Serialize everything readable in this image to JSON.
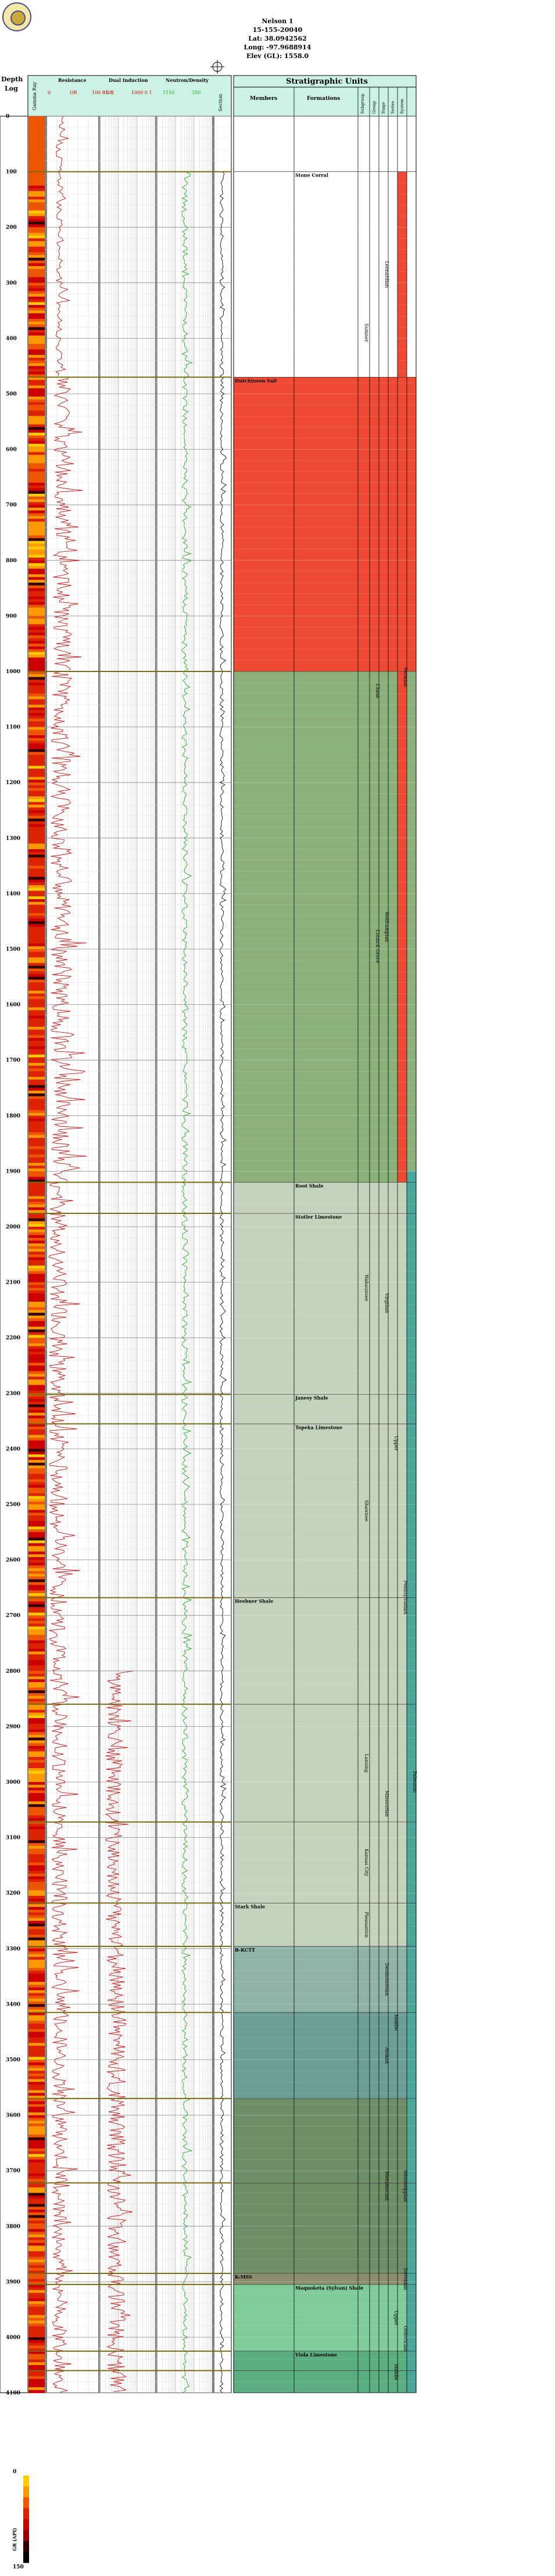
{
  "header": {
    "well_name": "Nelson 1",
    "api": "15-155-20040",
    "lat": "Lat: 38.0942562",
    "long": "Long: -97.9688914",
    "elev": "Elev (GL): 1558.0"
  },
  "track_headers": {
    "depth": "Depth",
    "log": "Log",
    "gamma": "Gamma Ray",
    "resistance": "Resistance",
    "resistance_scale": [
      "0",
      "OR",
      "100 0 0 2"
    ],
    "induction": "Dual Induction",
    "induction_scale": [
      "31.8",
      "1000 0 1"
    ],
    "neutron": "Neutron/Density",
    "neutron_scale": [
      "1150",
      "350"
    ],
    "section": "Section",
    "strat_title": "Stratigraphic Units",
    "members": "Members",
    "formations": "Formations",
    "subgroup": "Subgroup",
    "group": "Group",
    "stage": "Stage",
    "series": "Series",
    "system": "System"
  },
  "colors": {
    "header_fill": "#ccf2e6",
    "permian": "#ee4a33",
    "pennsylvanian_light": "#8cb07a",
    "pennsylvanian_upper": "#c4d3bb",
    "pennsylvanian_middle": "#8fb3a7",
    "atokan": "#6a9e96",
    "mississippian": "#6e8e67",
    "devonian": "#7fcb9a",
    "ordovician": "#5aae7f",
    "curve_red": "#cc1111",
    "curve_green": "#22aa22"
  },
  "chart_data": {
    "type": "well_log",
    "depth_label": "Depth",
    "depth_ticks": [
      "0",
      "100",
      "200",
      "300",
      "400",
      "500",
      "600",
      "700",
      "800",
      "900",
      "1000",
      "1100",
      "1200",
      "1300",
      "1400",
      "1500",
      "1600",
      "1700",
      "1800",
      "1900",
      "2000",
      "2100",
      "2200",
      "2300",
      "2400",
      "2500",
      "2600",
      "2700",
      "2800",
      "2900",
      "3000",
      "3100",
      "3200",
      "3300",
      "3400",
      "3500",
      "3600",
      "3700",
      "3800",
      "3900",
      "4000",
      "4100"
    ],
    "depth_range": [
      0,
      4100
    ],
    "formation_tops": [
      {
        "name": "Stone Corral",
        "depth": 100
      },
      {
        "name": "Hutchinson Salt",
        "depth": 470
      },
      {
        "name": "",
        "depth": 1000
      },
      {
        "name": "Root Shale",
        "depth": 1920
      },
      {
        "name": "Stotler Limestone",
        "depth": 1976
      },
      {
        "name": "Janesy Shale",
        "depth": 2302
      },
      {
        "name": "Topeka Limestone",
        "depth": 2355
      },
      {
        "name": "Heebner Shale",
        "depth": 2668
      },
      {
        "name": "",
        "depth": 2860
      },
      {
        "name": "",
        "depth": 3072
      },
      {
        "name": "Stark Shale",
        "depth": 3218
      },
      {
        "name": "B-KCTT",
        "depth": 3296
      },
      {
        "name": "",
        "depth": 3415
      },
      {
        "name": "",
        "depth": 3570
      },
      {
        "name": "",
        "depth": 3722
      },
      {
        "name": "K-MSS",
        "depth": 3885
      },
      {
        "name": "Maquoketa (Sylvan) Shale",
        "depth": 3905
      },
      {
        "name": "Viola Limestone",
        "depth": 4025
      },
      {
        "name": "",
        "depth": 4060
      }
    ],
    "units": [
      {
        "from": 0,
        "to": 100,
        "color": "#ffffff"
      },
      {
        "from": 100,
        "to": 470,
        "color": "#ffffff"
      },
      {
        "from": 470,
        "to": 1000,
        "color": "#ee4a33"
      },
      {
        "from": 1000,
        "to": 1920,
        "color": "#8cb07a"
      },
      {
        "from": 1920,
        "to": 3296,
        "color": "#c4d3bb"
      },
      {
        "from": 3296,
        "to": 3415,
        "color": "#8fb3a7"
      },
      {
        "from": 3415,
        "to": 3570,
        "color": "#6a9e96"
      },
      {
        "from": 3570,
        "to": 3885,
        "color": "#6e8e67"
      },
      {
        "from": 3885,
        "to": 3905,
        "color": "#8c8c6e"
      },
      {
        "from": 3905,
        "to": 4025,
        "color": "#7fcb9a"
      },
      {
        "from": 4025,
        "to": 4100,
        "color": "#5aae7f"
      }
    ],
    "strat_columns": {
      "group": [
        {
          "name": "Chase",
          "from": 1000,
          "to": 1070
        },
        {
          "name": "Council Grove",
          "from": 1070,
          "to": 1920
        }
      ],
      "subgroup": [
        {
          "name": "Sumner",
          "from": 280,
          "to": 500
        },
        {
          "name": "Wabaunsee",
          "from": 1920,
          "to": 2300
        },
        {
          "name": "Shawnee",
          "from": 2355,
          "to": 2668
        },
        {
          "name": "Lansing",
          "from": 2860,
          "to": 3072
        },
        {
          "name": "Kansas City",
          "from": 3072,
          "to": 3218
        },
        {
          "name": "Pleasanton",
          "from": 3218,
          "to": 3296
        }
      ],
      "stage": [
        {
          "name": "Leonardian",
          "from": 100,
          "to": 470
        },
        {
          "name": "Wolfcampian",
          "from": 1000,
          "to": 1920
        },
        {
          "name": "Virgilian",
          "from": 1920,
          "to": 2355
        },
        {
          "name": "Missourian",
          "from": 2860,
          "to": 3218
        },
        {
          "name": "Desmoinesian",
          "from": 3296,
          "to": 3415
        },
        {
          "name": "Atokan",
          "from": 3415,
          "to": 3570
        },
        {
          "name": "Meramecian",
          "from": 3570,
          "to": 3885
        }
      ],
      "series": [
        {
          "name": "Upper",
          "from": 1920,
          "to": 2860
        },
        {
          "name": "Middle",
          "from": 3296,
          "to": 3570
        },
        {
          "name": "Upper",
          "from": 3905,
          "to": 4025
        },
        {
          "name": "Middle",
          "from": 4025,
          "to": 4100
        }
      ],
      "system": [
        {
          "name": "Permian",
          "from": 100,
          "to": 1920
        },
        {
          "name": "Pennsylvanian",
          "from": 1920,
          "to": 3415
        },
        {
          "name": "Mississippian",
          "from": 3570,
          "to": 3885
        },
        {
          "name": "Devonian",
          "from": 3885,
          "to": 3905
        },
        {
          "name": "Ordovician",
          "from": 3905,
          "to": 4100
        }
      ],
      "era": [
        {
          "name": "Paleozoic",
          "from": 1900,
          "to": 4100
        }
      ]
    },
    "gamma_legend": {
      "label": "GR (API)",
      "min": "0",
      "max": "150"
    }
  }
}
